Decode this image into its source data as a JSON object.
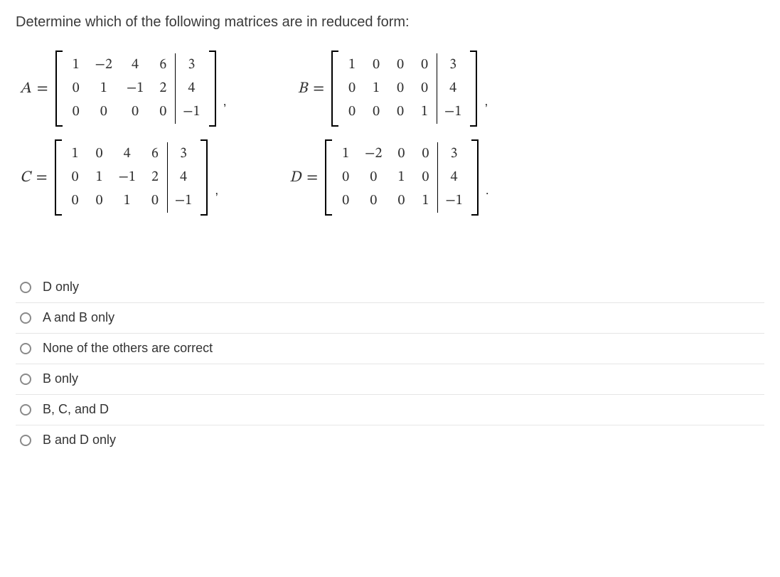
{
  "question": "Determine which of the following matrices are in reduced form:",
  "matrices": {
    "A": {
      "label": "A",
      "rows": [
        [
          "1",
          "−2",
          "4",
          "6",
          "3"
        ],
        [
          "0",
          "1",
          "−1",
          "2",
          "4"
        ],
        [
          "0",
          "0",
          "0",
          "0",
          "−1"
        ]
      ],
      "augment_col": 4,
      "trail": ","
    },
    "B": {
      "label": "B",
      "rows": [
        [
          "1",
          "0",
          "0",
          "0",
          "3"
        ],
        [
          "0",
          "1",
          "0",
          "0",
          "4"
        ],
        [
          "0",
          "0",
          "0",
          "1",
          "−1"
        ]
      ],
      "augment_col": 4,
      "trail": ","
    },
    "C": {
      "label": "C",
      "rows": [
        [
          "1",
          "0",
          "4",
          "6",
          "3"
        ],
        [
          "0",
          "1",
          "−1",
          "2",
          "4"
        ],
        [
          "0",
          "0",
          "1",
          "0",
          "−1"
        ]
      ],
      "augment_col": 4,
      "trail": ","
    },
    "D": {
      "label": "D",
      "rows": [
        [
          "1",
          "−2",
          "0",
          "0",
          "3"
        ],
        [
          "0",
          "0",
          "1",
          "0",
          "4"
        ],
        [
          "0",
          "0",
          "0",
          "1",
          "−1"
        ]
      ],
      "augment_col": 4,
      "trail": "."
    }
  },
  "options": [
    "D only",
    "A and B only",
    "None of the others are correct",
    "B only",
    "B, C, and D",
    "B and D only"
  ]
}
